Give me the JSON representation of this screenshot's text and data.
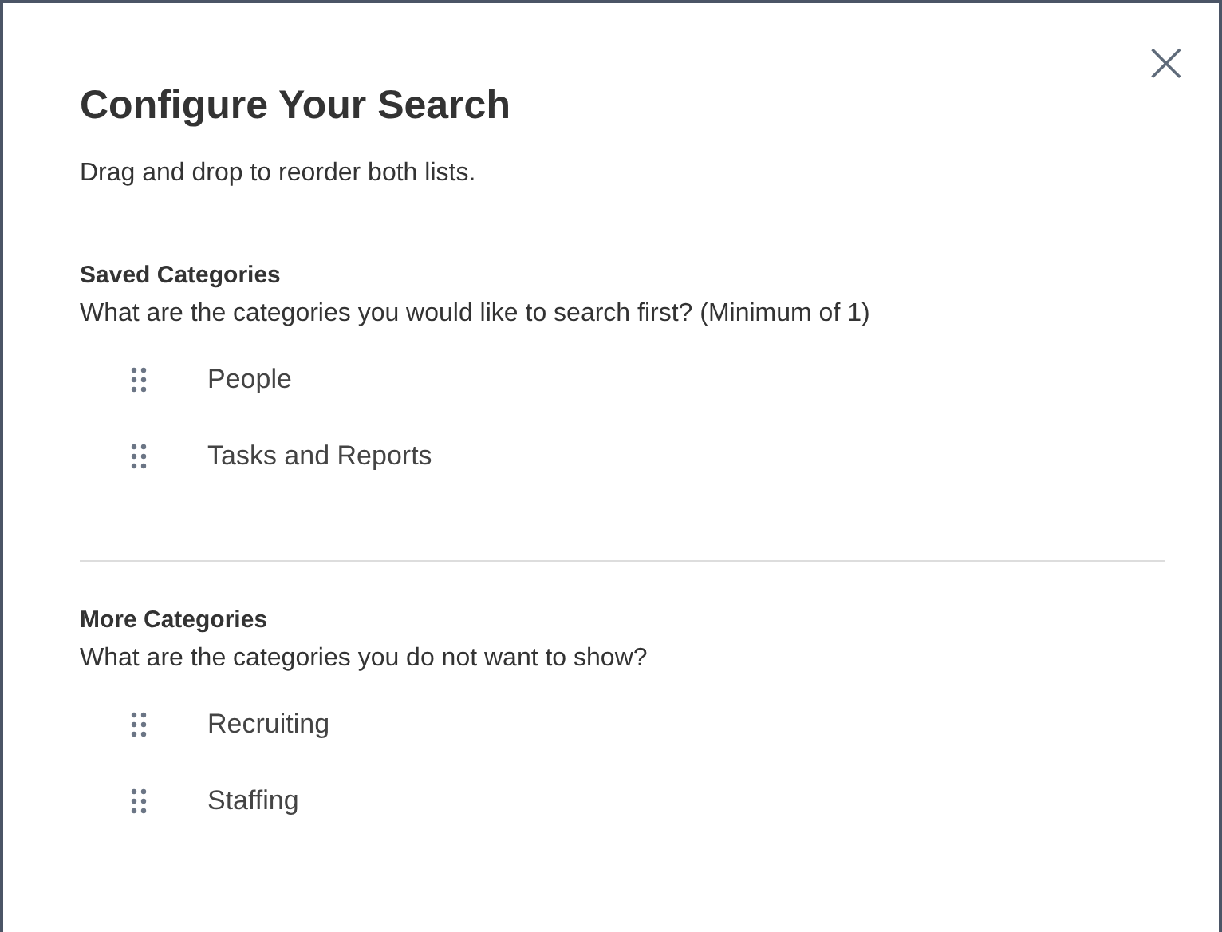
{
  "dialog": {
    "title": "Configure Your Search",
    "subtitle": "Drag and drop to reorder both lists.",
    "close_icon": "×"
  },
  "sections": [
    {
      "heading": "Saved Categories",
      "description": "What are the categories you would like to search first? (Minimum of 1)",
      "items": [
        {
          "label": "People"
        },
        {
          "label": "Tasks and Reports"
        }
      ]
    },
    {
      "heading": "More Categories",
      "description": "What are the categories you do not want to show?",
      "items": [
        {
          "label": "Recruiting"
        },
        {
          "label": "Staffing"
        }
      ]
    }
  ]
}
